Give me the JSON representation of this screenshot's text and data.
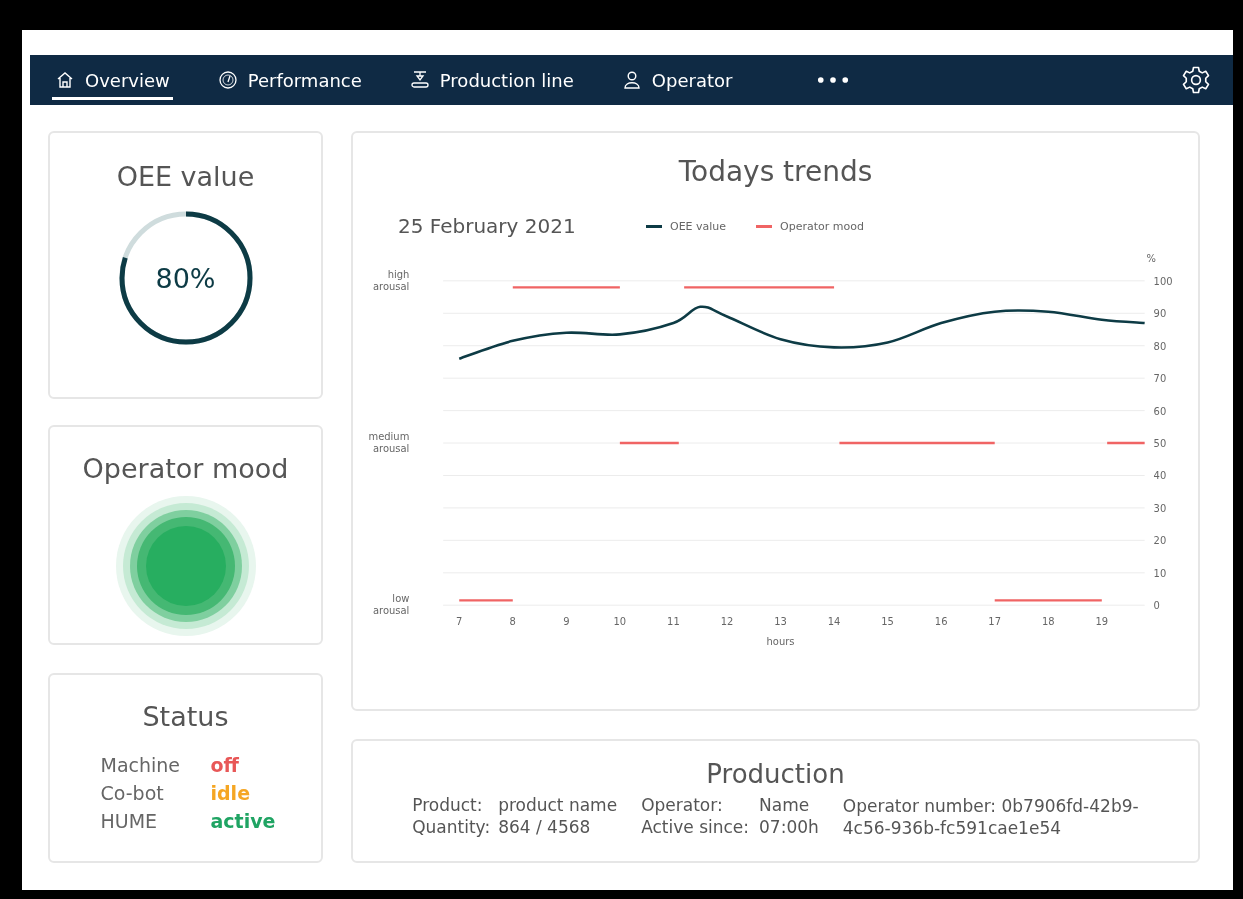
{
  "nav": {
    "items": [
      {
        "label": "Overview",
        "selected": true
      },
      {
        "label": "Performance",
        "selected": false
      },
      {
        "label": "Production line",
        "selected": false
      },
      {
        "label": "Operator",
        "selected": false
      }
    ]
  },
  "oee": {
    "title": "OEE value",
    "reading": "80%",
    "level": 0.8
  },
  "mood": {
    "title": "Operator mood"
  },
  "status": {
    "title": "Status",
    "items": [
      {
        "label": "Machine",
        "value": "off",
        "color": "#e85757"
      },
      {
        "label": "Co-bot",
        "value": "idle",
        "color": "#f5a623"
      },
      {
        "label": "HUME",
        "value": "active",
        "color": "#1fa463"
      }
    ]
  },
  "trends": {
    "title": "Todays trends",
    "date": "25 February 2021",
    "chart_data": {
      "type": "line",
      "xlabel": "hours",
      "ylabel": "%",
      "series": [
        {
          "name": "OEE value",
          "color": "#0d3b45",
          "x": [
            7,
            8,
            9,
            10,
            11,
            11.5,
            12,
            13,
            14,
            15,
            16,
            17,
            18,
            19,
            19.8
          ],
          "values": [
            76,
            81.5,
            84,
            83.5,
            87,
            92,
            89,
            82,
            79.5,
            81,
            87,
            90.5,
            90.5,
            88,
            87
          ]
        },
        {
          "name": "Operator mood",
          "color": "#f06464",
          "x": [
            7,
            8,
            8,
            10,
            10,
            11.1,
            11.2,
            14,
            14.1,
            17,
            17,
            19,
            19.1,
            19.8
          ],
          "values": [
            1.5,
            1.5,
            98,
            98,
            50,
            50,
            98,
            98,
            50,
            50,
            1.5,
            1.5,
            50,
            50
          ]
        }
      ],
      "xlim": [
        6.7,
        19.8
      ],
      "ylim": [
        0,
        100
      ],
      "grid": true,
      "xticks": [
        7,
        8,
        9,
        10,
        11,
        12,
        13,
        14,
        15,
        16,
        17,
        18,
        19
      ],
      "yticks": [
        0,
        10,
        20,
        30,
        40,
        50,
        60,
        70,
        80,
        90,
        100
      ]
    },
    "arousal_labels": [
      {
        "lines": [
          "high",
          "arousal"
        ]
      },
      {
        "lines": [
          "medium",
          "arousal"
        ]
      },
      {
        "lines": [
          "low",
          "arousal"
        ]
      }
    ]
  },
  "production": {
    "title": "Production",
    "fields": [
      {
        "label": "Product:",
        "value": "product name"
      },
      {
        "label": "Quantity:",
        "value": "864 / 4568"
      },
      {
        "label": "Operator:",
        "value": "Name"
      },
      {
        "label": "Active since:",
        "value": "07:00h"
      }
    ],
    "operator_number": "Operator number: 0b7906fd-42b9-4c56-936b-fc591cae1e54"
  }
}
